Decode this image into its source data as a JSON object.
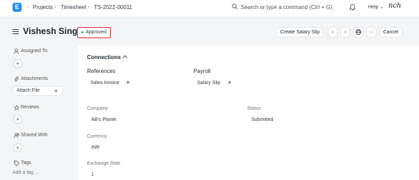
{
  "breadcrumb": [
    "Projects",
    "Timesheet",
    "TS-2022-00011"
  ],
  "navbar": {
    "logo": "E",
    "search_placeholder": "Search or type a command (Ctrl + G)",
    "help_label": "Help",
    "avatar_text": "nch"
  },
  "page": {
    "title": "Vishesh Singh",
    "status": "Approved",
    "create_salary_slip_label": "Create Salary Slip",
    "more_label": "···",
    "cancel_label": "Cancel"
  },
  "sidebar": {
    "assigned_to": "Assigned To",
    "attachments": "Attachments",
    "attach_file": "Attach File",
    "reviews": "Reviews",
    "shared_with": "Shared With",
    "tags": "Tags",
    "add_tag": "Add a tag ..."
  },
  "connections": {
    "title": "Connections",
    "references": {
      "label": "References",
      "item": "Sales Invoice"
    },
    "payroll": {
      "label": "Payroll",
      "item": "Salary Slip"
    }
  },
  "fields": {
    "company": {
      "label": "Company",
      "value": "AB's Planet"
    },
    "status": {
      "label": "Status",
      "value": "Submitted"
    },
    "currency": {
      "label": "Currency",
      "value": "INR"
    },
    "exchange_rate": {
      "label": "Exchange Rate",
      "value": "1"
    }
  },
  "colors": {
    "accent": "#2490ef",
    "highlight": "#e0242b",
    "status_dot": "#30a66d"
  }
}
